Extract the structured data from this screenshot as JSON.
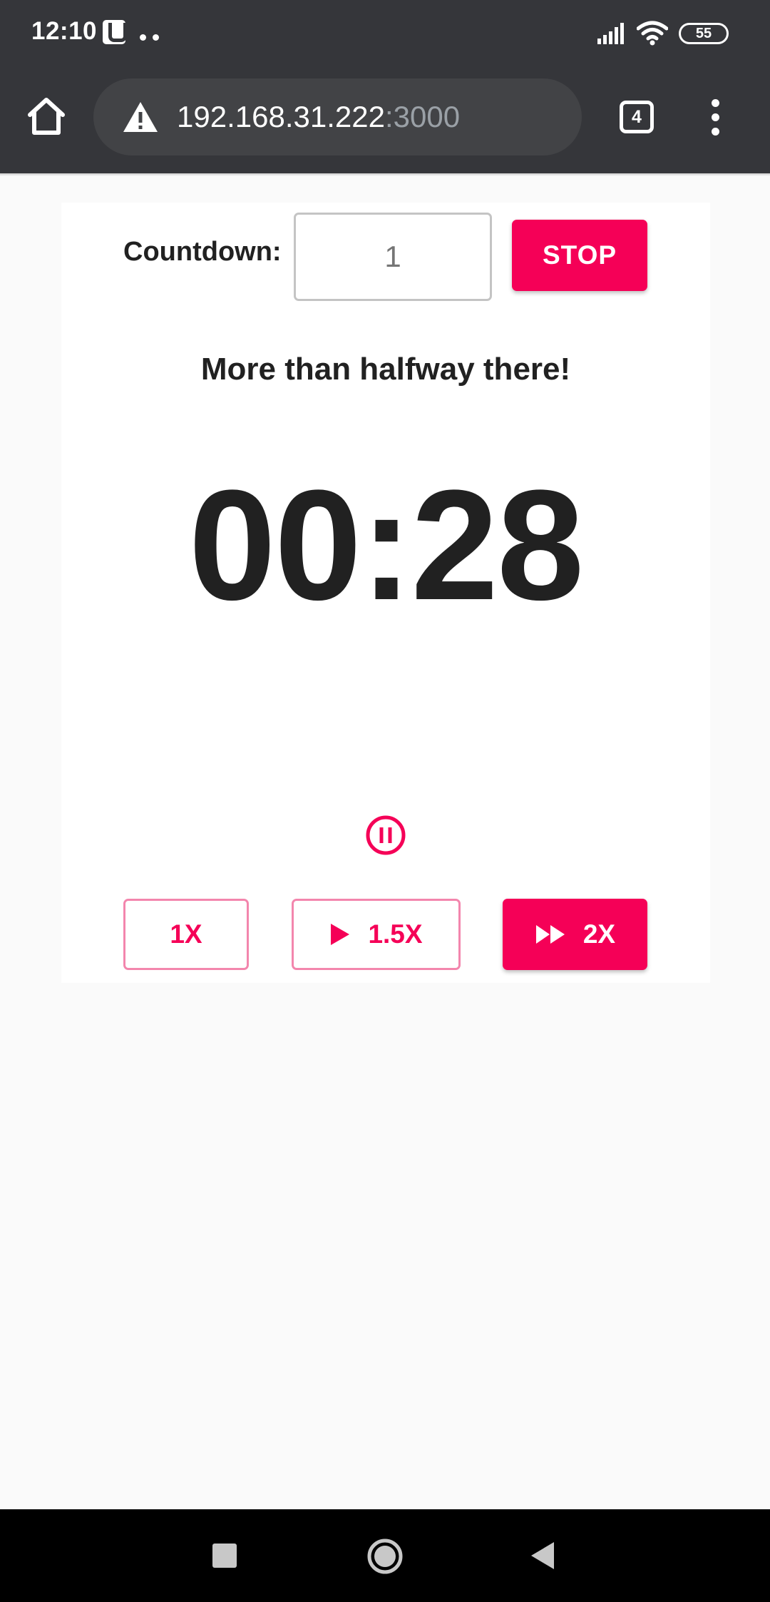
{
  "status_bar": {
    "time": "12:10",
    "battery": "55",
    "icons": [
      "u-icon",
      "dots-icon",
      "signal-icon",
      "wifi-icon",
      "battery-icon"
    ]
  },
  "browser": {
    "url_host": "192.168.31.222",
    "url_port": ":3000",
    "tab_count": "4",
    "icons": [
      "home-icon",
      "warning-icon",
      "tabs-icon",
      "more-vert-icon"
    ]
  },
  "timer": {
    "countdown_label": "Countdown:",
    "countdown_placeholder": "1",
    "stop_label": "STOP",
    "message": "More than halfway there!",
    "time_display": "00:28",
    "pause_icon": "pause-circle-icon"
  },
  "speed_controls": {
    "one_x": "1X",
    "one_five_x": "1.5X",
    "two_x": "2X",
    "selected": "2X"
  },
  "colors": {
    "accent": "#f50057",
    "toolbar": "#35363a",
    "text": "#212121"
  },
  "nav_bar": {
    "icons": [
      "recents-icon",
      "home-circle-icon",
      "back-icon"
    ]
  }
}
